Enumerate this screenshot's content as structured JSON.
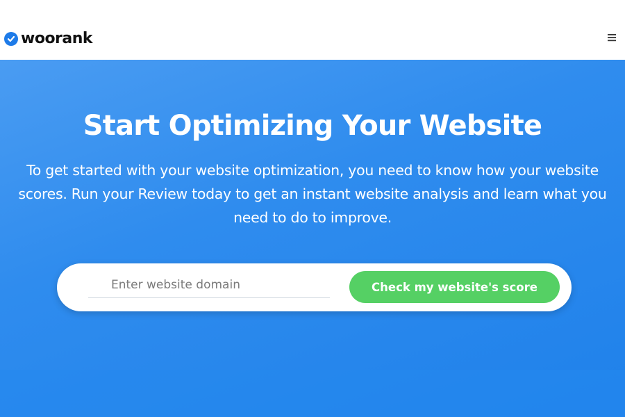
{
  "header": {
    "logo_text": "woorank",
    "menu_icon": "hamburger-menu-icon"
  },
  "hero": {
    "title": "Start Optimizing Your Website",
    "description": "To get started with your website optimization, you need to know how your website scores. Run your Review today to get an instant website analysis and learn what you need to do to improve."
  },
  "search": {
    "placeholder": "Enter website domain",
    "value": "",
    "button_label": "Check my website's score"
  },
  "colors": {
    "brand_blue": "#1e7be8",
    "hero_background": "#2f8cee",
    "cta_green": "#55d064"
  }
}
